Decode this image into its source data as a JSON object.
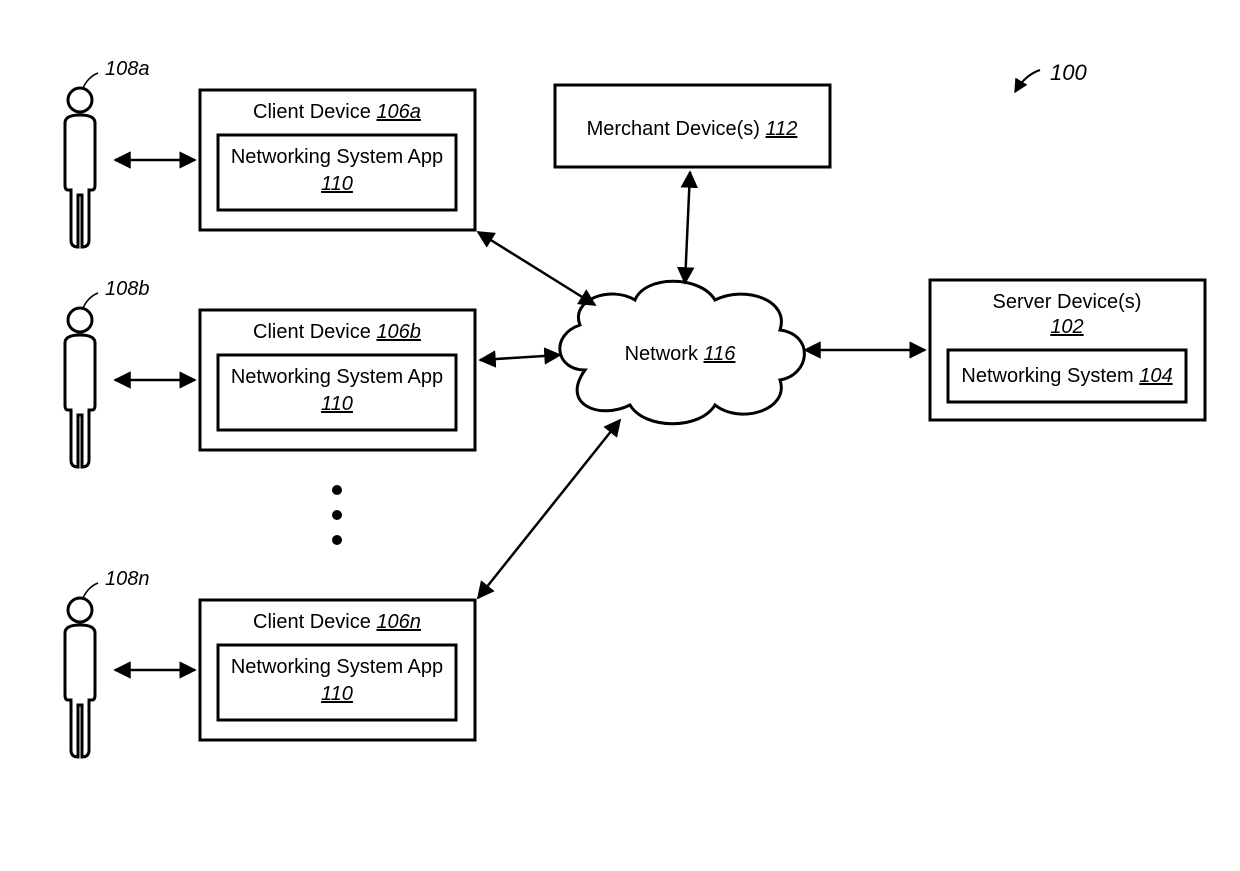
{
  "diagram_ref": "100",
  "users": [
    {
      "ref": "108a"
    },
    {
      "ref": "108b"
    },
    {
      "ref": "108n"
    }
  ],
  "clients": [
    {
      "title": "Client Device",
      "ref": "106a",
      "inner_title": "Networking System App",
      "inner_ref": "110"
    },
    {
      "title": "Client Device",
      "ref": "106b",
      "inner_title": "Networking System App",
      "inner_ref": "110"
    },
    {
      "title": "Client Device",
      "ref": "106n",
      "inner_title": "Networking System App",
      "inner_ref": "110"
    }
  ],
  "merchant": {
    "title": "Merchant Device(s)",
    "ref": "112"
  },
  "network": {
    "title": "Network",
    "ref": "116"
  },
  "server": {
    "title": "Server Device(s)",
    "ref": "102",
    "inner_title": "Networking System",
    "inner_ref": "104"
  }
}
